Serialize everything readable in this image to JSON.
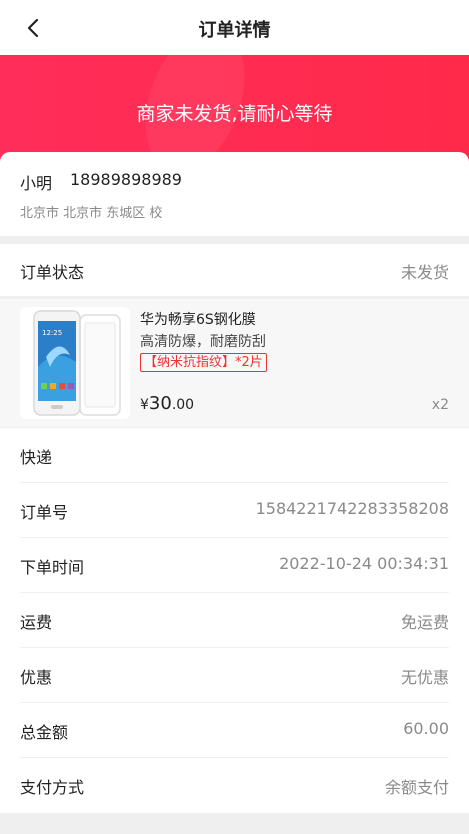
{
  "nav": {
    "title": "订单详情"
  },
  "banner": {
    "text": "商家未发货,请耐心等待"
  },
  "address": {
    "name": "小明",
    "phone": "18989898989",
    "line": "北京市 北京市 东城区 校"
  },
  "status": {
    "label": "订单状态",
    "value": "未发货"
  },
  "product": {
    "name": "华为畅享6S钢化膜",
    "desc": "高清防爆，耐磨防刮",
    "tag": "【纳米抗指纹】*2片",
    "currency": "¥",
    "price_int": "30",
    "price_dec": ".00",
    "qty": "x2",
    "phone_time": "12:25"
  },
  "info": {
    "shipping_label": "快递",
    "order_no_label": "订单号",
    "order_no": "1584221742283358208",
    "time_label": "下单时间",
    "time": "2022-10-24 00:34:31",
    "freight_label": "运费",
    "freight": "免运费",
    "discount_label": "优惠",
    "discount": "无优惠",
    "total_label": "总金额",
    "total": "60.00",
    "pay_label": "支付方式",
    "pay": "余额支付"
  }
}
